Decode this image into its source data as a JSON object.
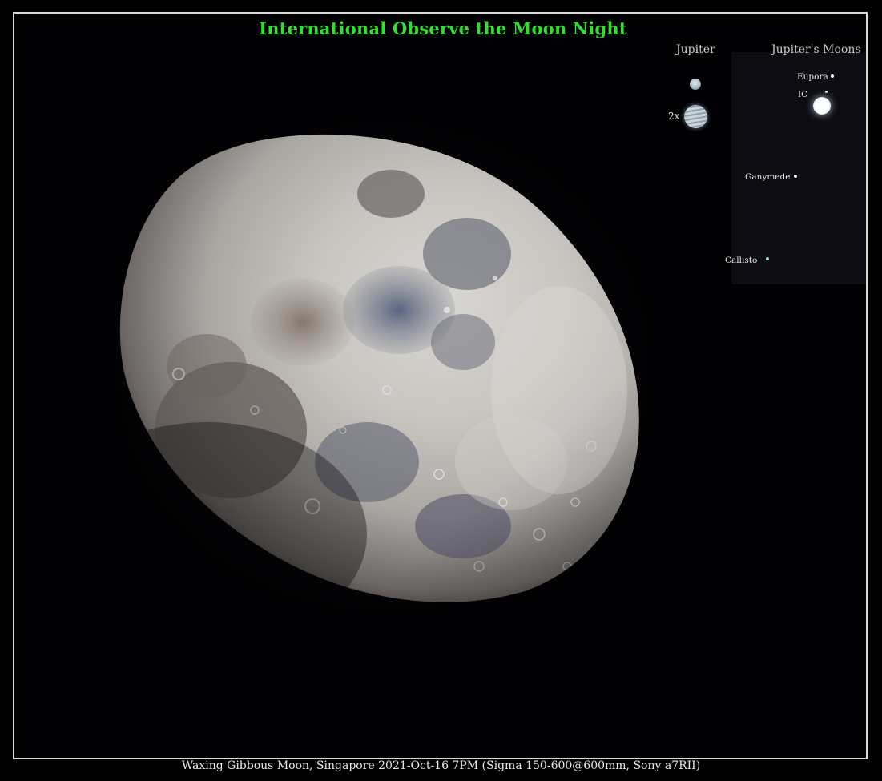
{
  "title": "International Observe the Moon Night",
  "caption": "Waxing Gibbous Moon, Singapore 2021-Oct-16 7PM (Sigma 150-600@600mm, Sony a7RII)",
  "inset": {
    "jupiter_heading": "Jupiter",
    "jupiter_zoom_label": "2x",
    "moons_heading": "Jupiter's Moons",
    "moons": {
      "europa": "Eupora",
      "io": "IO",
      "ganymede": "Ganymede",
      "callisto": "Callisto"
    }
  },
  "colors": {
    "background": "#000000",
    "frame": "#d8d8d8",
    "title": "#33dd33",
    "text": "#e0e0e0"
  }
}
